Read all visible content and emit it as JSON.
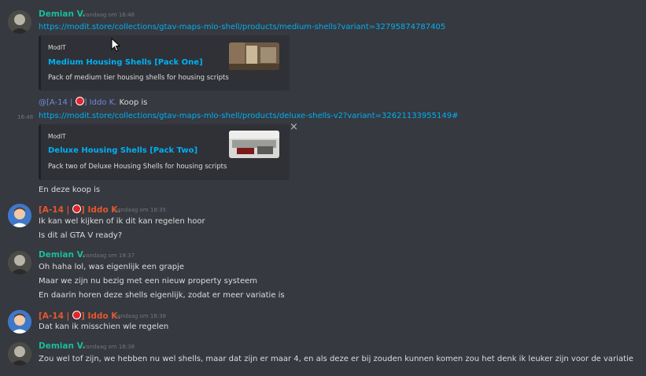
{
  "messages": {
    "m1": {
      "author": "Demian V.",
      "timestamp": "vandaag om 16:46",
      "link": "https://modit.store/collections/gtav-maps-mlo-shell/products/medium-shells?variant=32795874787405",
      "embed": {
        "provider": "ModIT",
        "title": "Medium Housing Shells [Pack One]",
        "description": "Pack of medium tier housing shells for housing scripts"
      }
    },
    "m2": {
      "mention_prefix": "@[A-14 |",
      "mention_suffix": "] Iddo K.",
      "text": "Koop is"
    },
    "m3": {
      "side_timestamp": "16:48",
      "link": "https://modit.store/collections/gtav-maps-mlo-shell/products/deluxe-shells-v2?variant=32621133955149#",
      "close_icon": "×",
      "embed": {
        "provider": "ModIT",
        "title": "Deluxe Housing Shells [Pack Two]",
        "description": "Pack two of Deluxe Housing Shells for housing scripts"
      }
    },
    "m4": {
      "text": "En deze koop is"
    },
    "m5": {
      "author_prefix": "[A-14 |",
      "author_suffix": "] Iddo K.",
      "timestamp": "vandaag om 18:35",
      "lines": [
        "Ik kan wel kijken of ik dit kan regelen hoor",
        "Is dit al GTA V ready?"
      ]
    },
    "m6": {
      "author": "Demian V.",
      "timestamp": "vandaag om 18:37",
      "lines": [
        "Oh haha lol, was eigenlijk een grapje",
        "Maar we zijn nu bezig met een nieuw property systeem",
        "En daarin horen deze shells eigenlijk, zodat er meer variatie is"
      ]
    },
    "m7": {
      "author_prefix": "[A-14 |",
      "author_suffix": "] Iddo K.",
      "timestamp": "vandaag om 18:38",
      "lines": [
        "Dat kan ik misschien wle regelen"
      ]
    },
    "m8": {
      "author": "Demian V.",
      "timestamp": "vandaag om 18:38",
      "lines": [
        "Zou wel tof zijn, we hebben nu wel shells, maar dat zijn er maar 4, en als deze er bij zouden kunnen komen zou het denk ik leuker zijn voor de variatie"
      ]
    }
  },
  "colors": {
    "background": "#36393f",
    "embed_bg": "#2f3136",
    "link": "#00b0f4",
    "demian_name": "#1abc9c",
    "iddo_name": "#e4572e",
    "mention": "#7289da"
  }
}
